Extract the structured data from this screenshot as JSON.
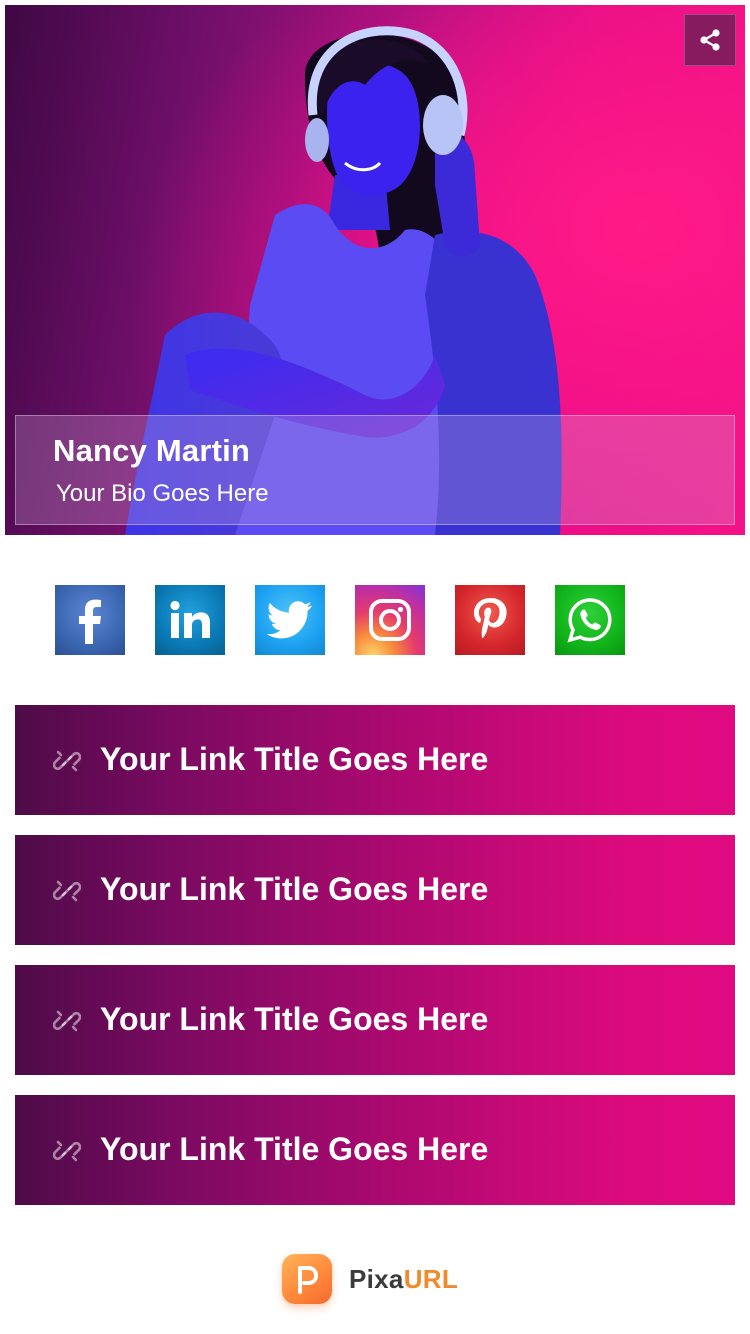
{
  "profile": {
    "name": "Nancy Martin",
    "bio": "Your Bio Goes Here"
  },
  "socials": [
    {
      "name": "facebook-icon",
      "color": "#3b67b2"
    },
    {
      "name": "linkedin-icon",
      "color": "#0a79b5"
    },
    {
      "name": "twitter-icon",
      "color": "#1da1f2"
    },
    {
      "name": "instagram-icon",
      "color": "#d62e7a"
    },
    {
      "name": "pinterest-icon",
      "color": "#d5262c"
    },
    {
      "name": "whatsapp-icon",
      "color": "#12b41b"
    }
  ],
  "links": [
    {
      "title": "Your Link Title Goes Here"
    },
    {
      "title": "Your Link Title Goes Here"
    },
    {
      "title": "Your Link Title Goes Here"
    },
    {
      "title": "Your Link Title Goes Here"
    }
  ],
  "brand": {
    "part1": "Pixa",
    "part2": "URL"
  },
  "colors": {
    "accent_pink": "#e00a80",
    "accent_purple": "#4e0b48",
    "brand_orange": "#f08a2a"
  }
}
